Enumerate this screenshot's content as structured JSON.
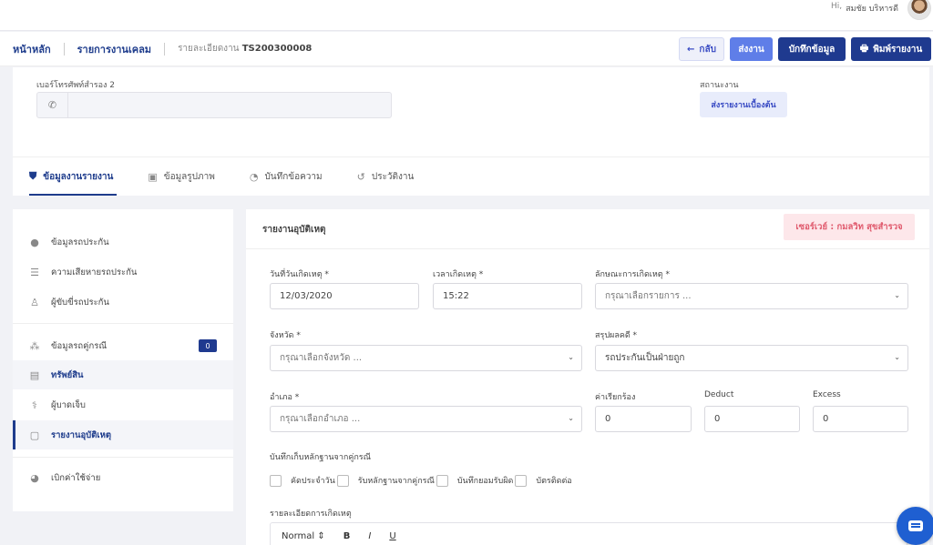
{
  "header": {
    "greeting": "Hi,",
    "user_name": "สมชัย บริหารดี"
  },
  "breadcrumb": {
    "home": "หน้าหลัก",
    "claims": "รายการงานเคลม",
    "detail_prefix": "รายละเอียดงาน",
    "job_id": "TS200300008"
  },
  "toolbar": {
    "back_label": "กลับ",
    "back_icon": "←",
    "send_label": "ส่งงาน",
    "save_label": "บักทึกข้อมูล",
    "print_label": "พิมพ์รายงาน",
    "print_icon": "🖶"
  },
  "contact": {
    "phone2_label": "เบอร์โทรศัพท์สำรอง 2",
    "phone2_value": "",
    "phone_icon": "✆"
  },
  "status": {
    "label": "สถานะงาน",
    "value": "ส่งรายงานเบื้องต้น"
  },
  "tabs": [
    {
      "label": "ข้อมูลงานรายงาน",
      "icon": "⛊"
    },
    {
      "label": "ข้อมูลรูปภาพ",
      "icon": "▣"
    },
    {
      "label": "บันทึกข้อความ",
      "icon": "◔"
    },
    {
      "label": "ประวัติงาน",
      "icon": "↺"
    }
  ],
  "sidebar": {
    "items": [
      {
        "label": "ข้อมูลรถประกัน",
        "icon": "●"
      },
      {
        "label": "ความเสียหายรถประกัน",
        "icon": "☰"
      },
      {
        "label": "ผู้ขับขี่รถประกัน",
        "icon": "♙"
      },
      {
        "label": "ข้อมูลรถคู่กรณี",
        "icon": "⁂",
        "badge": "0"
      },
      {
        "label": "ทรัพย์สิน",
        "icon": "▤"
      },
      {
        "label": "ผู้บาดเจ็บ",
        "icon": "⚕"
      },
      {
        "label": "รายงานอุบัติเหตุ",
        "icon": "▢"
      },
      {
        "label": "เบิกค่าใช้จ่าย",
        "icon": "◕"
      }
    ]
  },
  "report": {
    "title": "รายงานอุบัติเหตุ",
    "surveyor": "เซอร์เวย์ : กมลวิท สุขสำรวจ",
    "date_label": "วันที่วันเกิดเหตุ *",
    "date_value": "12/03/2020",
    "time_label": "เวลาเกิดเหตุ *",
    "time_value": "15:22",
    "nature_label": "ลักษณะการเกิดเหตุ *",
    "nature_placeholder": "กรุณาเลือกรายการ ...",
    "province_label": "จังหวัด *",
    "province_placeholder": "กรุณาเลือกจังหวัด ...",
    "result_label": "สรุปผลคดี *",
    "result_value": "รถประกันเป็นฝ่ายถูก",
    "district_label": "อำเภอ *",
    "district_placeholder": "กรุณาเลือกอำเภอ ...",
    "claim_label": "ค่าเรียกร้อง",
    "claim_value": "0",
    "deduct_label": "Deduct",
    "deduct_value": "0",
    "excess_label": "Excess",
    "excess_value": "0",
    "evidence_label": "บันทึกเก็บหลักฐานจากคู่กรณี",
    "evidence_options": [
      "คัดประจำวัน",
      "รับหลักฐานจากคู่กรณี",
      "บันทึกยอมรับผิด",
      "บัตรติดต่อ"
    ],
    "details_label": "รายละเอียดการเกิดเหตุ",
    "editor": {
      "style": "Normal",
      "bold": "B",
      "italic": "I",
      "underline": "U"
    }
  }
}
